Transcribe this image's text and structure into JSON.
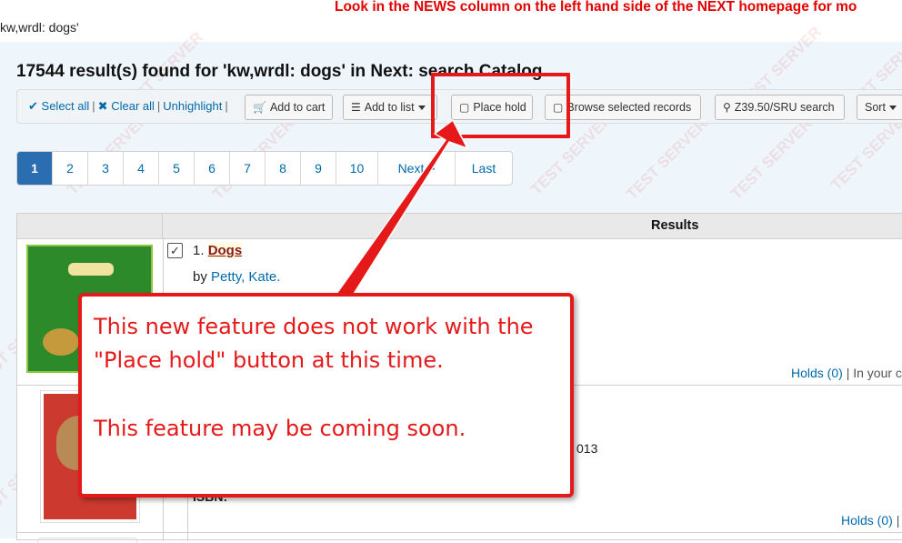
{
  "banner": {
    "text": "Look in the NEWS column on the left hand side of the NEXT homepage for mo"
  },
  "breadcrumb": {
    "text": "kw,wrdl: dogs'"
  },
  "results_heading": "17544 result(s) found for 'kw,wrdl: dogs' in Next: search Catalog.",
  "watermark": "TEST SERVER",
  "toolbar": {
    "select_all": "Select all",
    "clear_all": "Clear all",
    "unhighlight": "Unhighlight",
    "separator": "|",
    "add_to_cart": "Add to cart",
    "add_to_list": "Add to list",
    "place_hold": "Place hold",
    "browse_selected": "Browse selected records",
    "z3950": "Z39.50/SRU search",
    "sort": "Sort"
  },
  "pagination": {
    "pages": [
      "1",
      "2",
      "3",
      "4",
      "5",
      "6",
      "7",
      "8",
      "9",
      "10"
    ],
    "current": "1",
    "next": "Next >",
    "last": "Last"
  },
  "table": {
    "results_header": "Results",
    "rows": [
      {
        "number": "1.",
        "title": "Dogs",
        "by": "by",
        "author": "Petty, Kate.",
        "holds": "Holds (0)",
        "holds_extra": "| In your c"
      },
      {
        "date_fragment": "013",
        "isbn_fragment": "ISBN:",
        "holds": "Holds (0)",
        "holds_extra": "|"
      }
    ]
  },
  "callout": {
    "line1": "This new feature does not work with the",
    "line2": "\"Place hold\" button at this time.",
    "line3": "This feature may be coming soon."
  },
  "colors": {
    "annotation_red": "#e5191a",
    "banner_red": "#e30000",
    "link_blue": "#006aab",
    "active_page": "#2a6db1",
    "page_bg": "#eef5fb"
  },
  "icons": [
    "check-icon",
    "x-icon",
    "cart-icon",
    "list-icon",
    "note-icon",
    "search-icon"
  ]
}
